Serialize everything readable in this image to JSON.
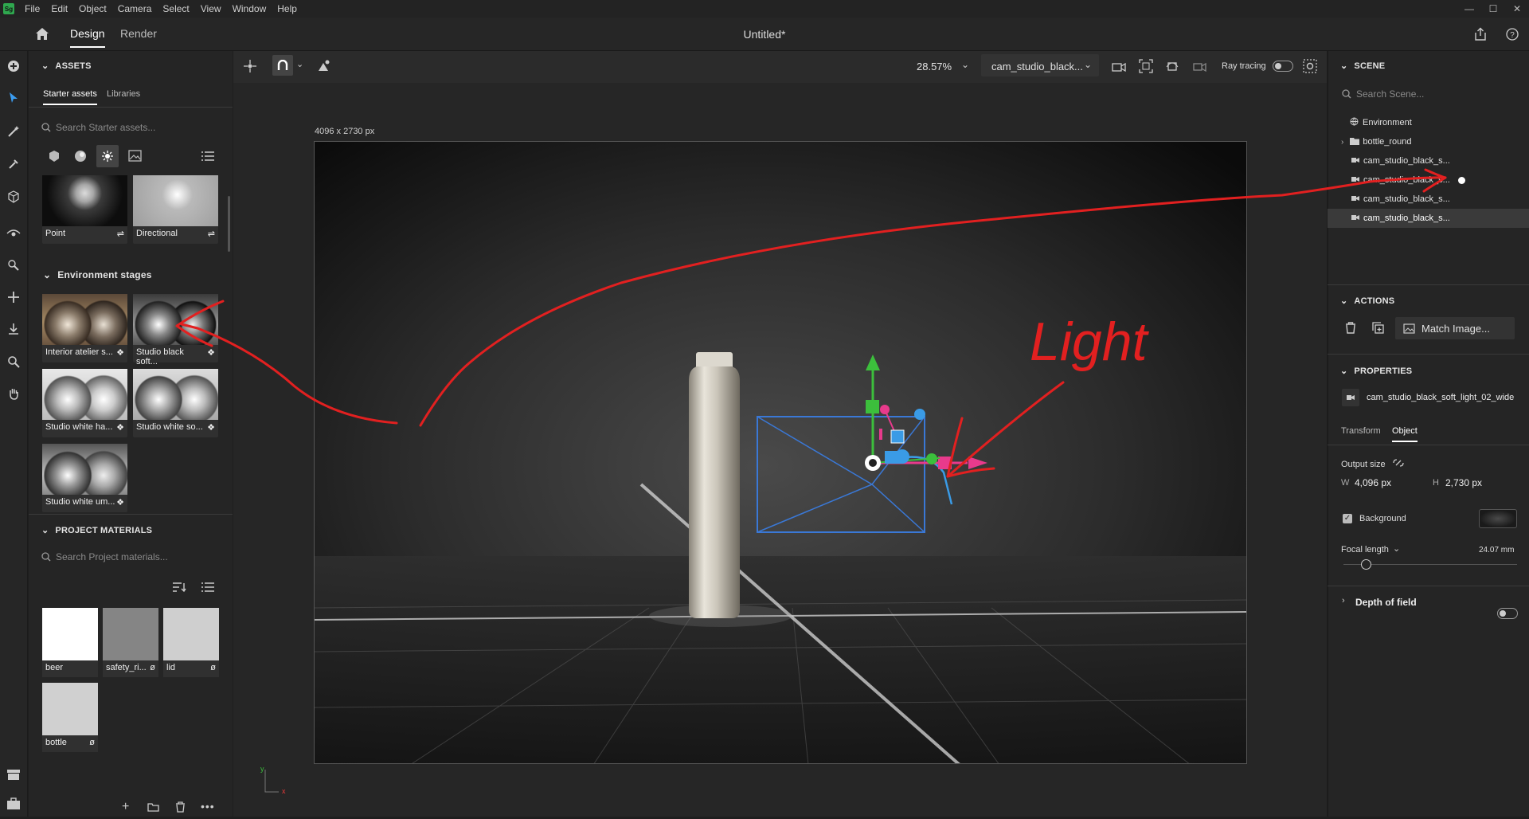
{
  "app": {
    "logo": "Sg",
    "title": "Untitled*"
  },
  "menu": [
    "File",
    "Edit",
    "Object",
    "Camera",
    "Select",
    "View",
    "Window",
    "Help"
  ],
  "tabs": {
    "design": "Design",
    "render": "Render"
  },
  "assets": {
    "heading": "ASSETS",
    "tab_starter": "Starter assets",
    "tab_libraries": "Libraries",
    "search_placeholder": "Search Starter assets...",
    "lights": [
      {
        "label": "Point"
      },
      {
        "label": "Directional"
      }
    ],
    "env_heading": "Environment stages",
    "env_items": [
      {
        "label": "Interior atelier s..."
      },
      {
        "label": "Studio black soft..."
      },
      {
        "label": "Studio white ha..."
      },
      {
        "label": "Studio white so..."
      },
      {
        "label": "Studio white um..."
      }
    ]
  },
  "project_materials": {
    "heading": "PROJECT MATERIALS",
    "search_placeholder": "Search Project materials...",
    "items": [
      {
        "label": "beer",
        "color": "#ffffff"
      },
      {
        "label": "safety_ri...",
        "color": "#858585"
      },
      {
        "label": "lid",
        "color": "#cfcfcf"
      },
      {
        "label": "bottle",
        "color": "#d0d0d0"
      }
    ]
  },
  "viewport": {
    "zoom": "28.57%",
    "camera": "cam_studio_black...",
    "ray_tracing_label": "Ray tracing",
    "ray_tracing": false,
    "canvas_size_label": "4096 x 2730 px",
    "annotation_text": "Light",
    "axis_y": "y",
    "axis_x": "x"
  },
  "scene": {
    "heading": "SCENE",
    "search_placeholder": "Search Scene...",
    "items": [
      {
        "label": "Environment",
        "icon": "globe-icon"
      },
      {
        "label": "bottle_round",
        "icon": "folder-icon",
        "expandable": true
      },
      {
        "label": "cam_studio_black_s...",
        "icon": "camera-icon"
      },
      {
        "label": "cam_studio_black_s...",
        "icon": "camera-icon"
      },
      {
        "label": "cam_studio_black_s...",
        "icon": "camera-icon"
      },
      {
        "label": "cam_studio_black_s...",
        "icon": "camera-icon",
        "selected": true
      }
    ]
  },
  "actions": {
    "heading": "ACTIONS",
    "match_image": "Match Image..."
  },
  "properties": {
    "heading": "PROPERTIES",
    "object_name": "cam_studio_black_soft_light_02_wide",
    "tab_transform": "Transform",
    "tab_object": "Object",
    "output_size_label": "Output size",
    "w_label": "W",
    "w_value": "4,096 px",
    "h_label": "H",
    "h_value": "2,730 px",
    "background_label": "Background",
    "background_checked": true,
    "focal_length_label": "Focal length",
    "focal_length_value": "24.07 mm",
    "depth_of_field_label": "Depth of field",
    "depth_of_field": false
  },
  "colors": {
    "accent": "#e22020",
    "selected_row": "#3a3a3a",
    "panel": "#252525"
  }
}
